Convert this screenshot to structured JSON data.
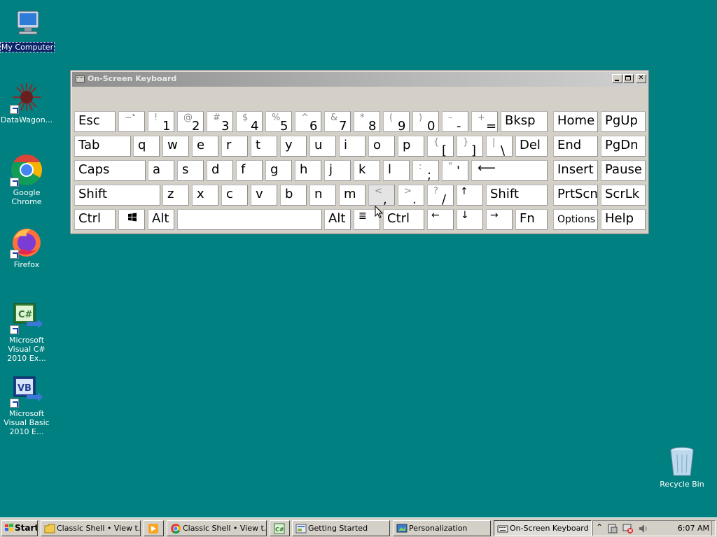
{
  "desktop": {
    "icons": [
      {
        "label": "My Computer",
        "icon": "computer-icon"
      },
      {
        "label": "DataWagon...",
        "icon": "datawagon-icon"
      },
      {
        "label": "Google Chrome",
        "icon": "chrome-icon"
      },
      {
        "label": "Firefox",
        "icon": "firefox-icon"
      },
      {
        "label": "Microsoft Visual C# 2010 Ex...",
        "icon": "visual-csharp-icon"
      },
      {
        "label": "Microsoft Visual Basic 2010 E...",
        "icon": "visual-basic-icon"
      },
      {
        "label": "Recycle Bin",
        "icon": "recycle-bin-icon"
      }
    ]
  },
  "osk": {
    "title": "On-Screen Keyboard",
    "keys": {
      "esc": "Esc",
      "tilde_top": "~",
      "tilde_bot": "`",
      "k1_top": "!",
      "k1_bot": "1",
      "k2_top": "@",
      "k2_bot": "2",
      "k3_top": "#",
      "k3_bot": "3",
      "k4_top": "$",
      "k4_bot": "4",
      "k5_top": "%",
      "k5_bot": "5",
      "k6_top": "^",
      "k6_bot": "6",
      "k7_top": "&",
      "k7_bot": "7",
      "k8_top": "*",
      "k8_bot": "8",
      "k9_top": "(",
      "k9_bot": "9",
      "k0_top": ")",
      "k0_bot": "0",
      "minus_top": "–",
      "minus_bot": "-",
      "equal_top": "+",
      "equal_bot": "=",
      "bksp": "Bksp",
      "home": "Home",
      "pgup": "PgUp",
      "tab": "Tab",
      "q": "q",
      "w": "w",
      "e": "e",
      "r": "r",
      "t": "t",
      "y": "y",
      "u": "u",
      "i": "i",
      "o": "o",
      "p": "p",
      "lbr_top": "{",
      "lbr_bot": "[",
      "rbr_top": "}",
      "rbr_bot": "]",
      "bsl_top": "|",
      "bsl_bot": "\\",
      "del": "Del",
      "end": "End",
      "pgdn": "PgDn",
      "caps": "Caps",
      "a": "a",
      "s": "s",
      "d": "d",
      "f": "f",
      "g": "g",
      "h": "h",
      "j": "j",
      "k": "k",
      "l": "l",
      "semi_top": ":",
      "semi_bot": ";",
      "quote_top": "\"",
      "quote_bot": "'",
      "enter": "⟵",
      "insert": "Insert",
      "pause": "Pause",
      "shift_l": "Shift",
      "z": "z",
      "x": "x",
      "c": "c",
      "v": "v",
      "b": "b",
      "n": "n",
      "m": "m",
      "comma_top": "<",
      "comma_bot": ",",
      "period_top": ">",
      "period_bot": ".",
      "slash_top": "?",
      "slash_bot": "/",
      "up": "↑",
      "shift_r": "Shift",
      "prtscn": "PrtScn",
      "scrlk": "ScrLk",
      "ctrl_l": "Ctrl",
      "alt_l": "Alt",
      "alt_r": "Alt",
      "menu": "≣",
      "ctrl_r": "Ctrl",
      "left": "←",
      "down": "↓",
      "right": "→",
      "fn": "Fn",
      "options": "Options",
      "help": "Help"
    }
  },
  "taskbar": {
    "start": "Start",
    "buttons": [
      {
        "label": "Classic Shell • View t...",
        "icon": "folder-icon"
      },
      {
        "label": "",
        "icon": "media-player-icon"
      },
      {
        "label": "Classic Shell • View t...",
        "icon": "chrome-icon"
      },
      {
        "label": "",
        "icon": "visual-csharp-icon"
      },
      {
        "label": "Getting Started",
        "icon": "getting-started-icon"
      },
      {
        "label": "Personalization",
        "icon": "personalization-icon"
      },
      {
        "label": "On-Screen Keyboard",
        "icon": "keyboard-icon"
      }
    ],
    "clock": "6:07 AM"
  },
  "colors": {
    "desktop": "#008080",
    "chrome": "#d4d0c8"
  }
}
